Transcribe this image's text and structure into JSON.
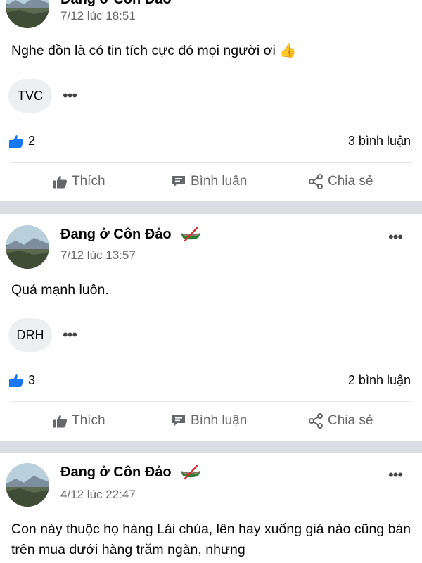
{
  "posts": [
    {
      "author": "Đang ở Côn Đảo",
      "time": "7/12 lúc 18:51",
      "content": "Nghe đồn là có tin tích cực đó mọi người ơi 👍",
      "commenter": "TVC",
      "likes": "2",
      "comments": "3 bình luận"
    },
    {
      "author": "Đang ở Côn Đảo",
      "time": "7/12 lúc 13:57",
      "content": "Quá mạnh luôn.",
      "commenter": "DRH",
      "likes": "3",
      "comments": "2 bình luận"
    },
    {
      "author": "Đang ở Côn Đảo",
      "time": "4/12 lúc 22:47",
      "content": "Con này thuộc họ hàng Lái chúa, lên hay xuống giá nào cũng bán trên mua dưới hàng trăm ngàn, nhưng"
    }
  ],
  "actions": {
    "like": "Thích",
    "comment": "Bình luận",
    "share": "Chia sẻ"
  },
  "more_glyph": "•••"
}
